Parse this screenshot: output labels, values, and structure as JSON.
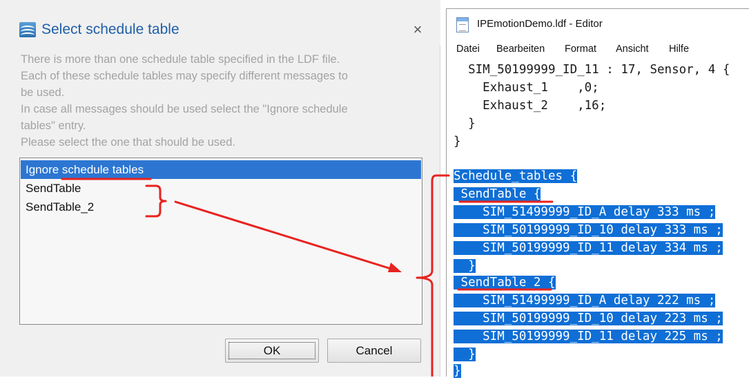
{
  "dialog": {
    "title": "Select schedule table",
    "close_symbol": "×",
    "description_lines": [
      "There is more than one schedule table specified in the LDF file.",
      "Each of these schedule tables may specify different messages to",
      "be used.",
      "In case all messages should be used select the \"Ignore schedule",
      "tables\" entry.",
      "Please select the one that should be used."
    ],
    "list_items": [
      {
        "label": "Ignore schedule tables",
        "selected": true
      },
      {
        "label": "SendTable",
        "selected": false
      },
      {
        "label": "SendTable_2",
        "selected": false
      }
    ],
    "ok_label": "OK",
    "cancel_label": "Cancel"
  },
  "editor": {
    "title": "IPEmotionDemo.ldf - Editor",
    "menu": [
      "Datei",
      "Bearbeiten",
      "Format",
      "Ansicht",
      "Hilfe"
    ],
    "code_lines": [
      {
        "text": "  SIM_50199999_ID_11 : 17, Sensor, 4 {",
        "selected": false
      },
      {
        "text": "    Exhaust_1    ,0;",
        "selected": false
      },
      {
        "text": "    Exhaust_2    ,16;",
        "selected": false
      },
      {
        "text": "  }",
        "selected": false
      },
      {
        "text": "}",
        "selected": false
      },
      {
        "text": "",
        "selected": false
      },
      {
        "text": "Schedule_tables {",
        "selected": true
      },
      {
        "text": " SendTable {",
        "selected": true
      },
      {
        "text": "    SIM_51499999_ID_A delay 333 ms ;",
        "selected": true
      },
      {
        "text": "    SIM_50199999_ID_10 delay 333 ms ;",
        "selected": true
      },
      {
        "text": "    SIM_50199999_ID_11 delay 334 ms ;",
        "selected": true
      },
      {
        "text": "  }",
        "selected": true
      },
      {
        "text": " SendTable_2 {",
        "selected": true
      },
      {
        "text": "    SIM_51499999_ID_A delay 222 ms ;",
        "selected": true
      },
      {
        "text": "    SIM_50199999_ID_10 delay 223 ms ;",
        "selected": true
      },
      {
        "text": "    SIM_50199999_ID_11 delay 225 ms ;",
        "selected": true
      },
      {
        "text": "  }",
        "selected": true
      },
      {
        "text": "}",
        "selected": true
      }
    ]
  },
  "colors": {
    "selection": "#0f6fd6",
    "list_selection": "#2c76d2",
    "dialog_title": "#1f5fa8",
    "annotation": "#e8231f"
  }
}
